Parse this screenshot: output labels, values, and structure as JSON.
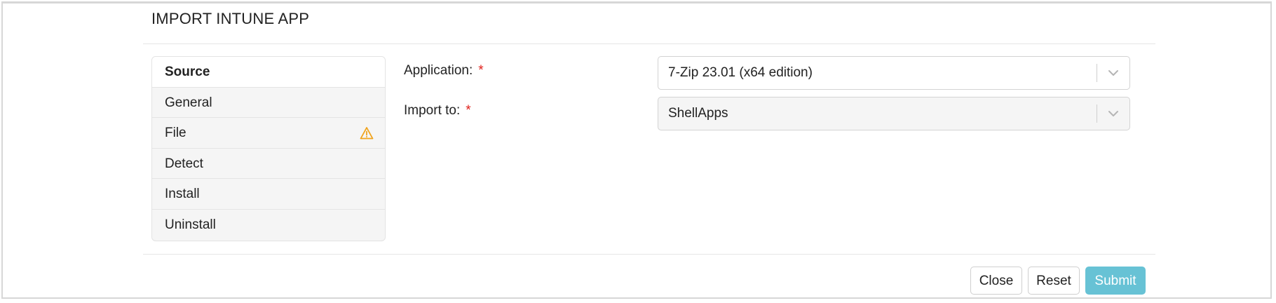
{
  "dialog": {
    "title": "IMPORT INTUNE APP"
  },
  "nav": {
    "items": [
      {
        "label": "Source",
        "active": true,
        "warning": false
      },
      {
        "label": "General",
        "active": false,
        "warning": false
      },
      {
        "label": "File",
        "active": false,
        "warning": true
      },
      {
        "label": "Detect",
        "active": false,
        "warning": false
      },
      {
        "label": "Install",
        "active": false,
        "warning": false
      },
      {
        "label": "Uninstall",
        "active": false,
        "warning": false
      }
    ]
  },
  "form": {
    "application": {
      "label": "Application:",
      "required_marker": "*",
      "value": "7-Zip 23.01 (x64 edition)"
    },
    "import_to": {
      "label": "Import to:",
      "required_marker": "*",
      "value": "ShellApps"
    }
  },
  "footer": {
    "close_label": "Close",
    "reset_label": "Reset",
    "submit_label": "Submit"
  },
  "colors": {
    "primary": "#67c2d5",
    "required": "#e0201b",
    "warning": "#f0a31c"
  }
}
